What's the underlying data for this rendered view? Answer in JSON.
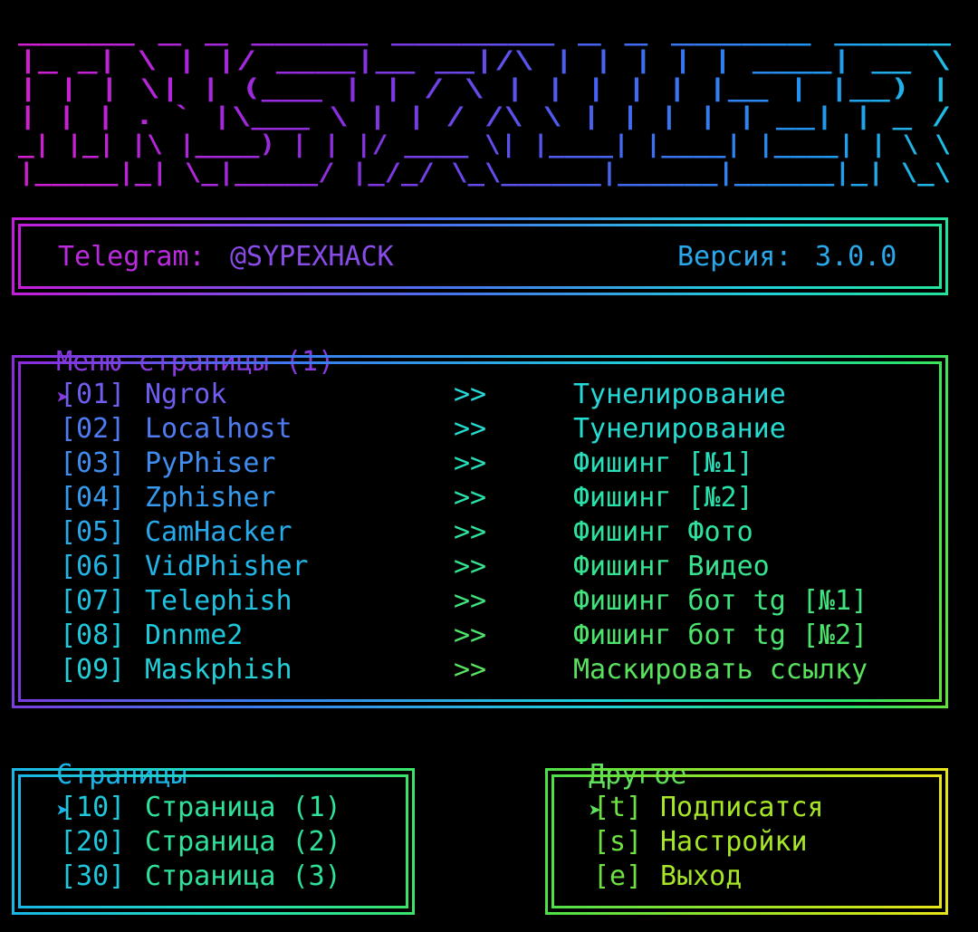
{
  "banner": {
    "lines": [
      " _____ _   _  _____ _______       _      _      ______ _____  ",
      "|_   _| \\ | |/ ____|__   __|/\\   | |    | |    |  ____|  __ \\ ",
      "  | | |  \\| | (___    | |  /  \\  | |    | |    | |__  | |__) |",
      "  | | | . ` |\\___ \\   | | / /\\ \\ | |    | |    |  __| |  _  / ",
      " _| |_| |\\  |____) |  | |/ ____ \\| |____| |____| |____| | \\ \\ ",
      "|_____|_| \\_|_____/   |_/_/    \\_\\______|______|______|_|  \\_\\"
    ]
  },
  "info": {
    "telegram_label": "Telegram:",
    "telegram_handle": "@SYPEXHACK",
    "version_label": "Версия:",
    "version_value": "3.0.0"
  },
  "menu_title": "Меню страницы (1)",
  "menu_items": [
    {
      "num": "[01]",
      "name": "Ngrok",
      "sep": ">>",
      "desc": "Тунелирование"
    },
    {
      "num": "[02]",
      "name": "Localhost",
      "sep": ">>",
      "desc": "Тунелирование"
    },
    {
      "num": "[03]",
      "name": "PyPhiser",
      "sep": ">>",
      "desc": "Фишинг [№1]"
    },
    {
      "num": "[04]",
      "name": "Zphisher",
      "sep": ">>",
      "desc": "Фишинг [№2]"
    },
    {
      "num": "[05]",
      "name": "CamHacker",
      "sep": ">>",
      "desc": "Фишинг Фото"
    },
    {
      "num": "[06]",
      "name": "VidPhisher",
      "sep": ">>",
      "desc": "Фишинг Видео"
    },
    {
      "num": "[07]",
      "name": "Telephish",
      "sep": ">>",
      "desc": "Фишинг бот tg [№1]"
    },
    {
      "num": "[08]",
      "name": "Dnnme2",
      "sep": ">>",
      "desc": "Фишинг бот tg [№2]"
    },
    {
      "num": "[09]",
      "name": "Maskphish",
      "sep": ">>",
      "desc": "Маскировать ссылку"
    }
  ],
  "pages_title": "Страницы",
  "pages_items": [
    {
      "num": "[10]",
      "label": "Страница (1)"
    },
    {
      "num": "[20]",
      "label": "Страница (2)"
    },
    {
      "num": "[30]",
      "label": "Страница (3)"
    }
  ],
  "other_title": "Другое",
  "other_items": [
    {
      "key": "[t]",
      "label": "Подписатся"
    },
    {
      "key": "[s]",
      "label": "Настройки"
    },
    {
      "key": "[e]",
      "label": "Выход"
    }
  ],
  "section_arrow": "➤",
  "colors": {
    "menu_rows": [
      "#6f5ff0",
      "#4f7cf2",
      "#3f8df0",
      "#349bee",
      "#27a9ea",
      "#22b6e6",
      "#1fc1e0",
      "#1ec9dc",
      "#22cfd8"
    ],
    "menu_desc": [
      "#26d8d8",
      "#25dccf",
      "#27dfba",
      "#29e1ab",
      "#2ee29e",
      "#36e38e",
      "#40e37d",
      "#4ce46b",
      "#58e35e"
    ],
    "pages_num": "#1ec8dc",
    "pages_label": "#2ee29a",
    "other_key": "#6ee043",
    "other_label": "#a6e627",
    "telegram_label": "#b92bdc",
    "telegram_handle": "#8a4ce8",
    "version": "#2aa8ea",
    "menu_title": "#8a3ae0",
    "pages_title": "#1cb4e8",
    "other_title": "#5ee05a"
  }
}
